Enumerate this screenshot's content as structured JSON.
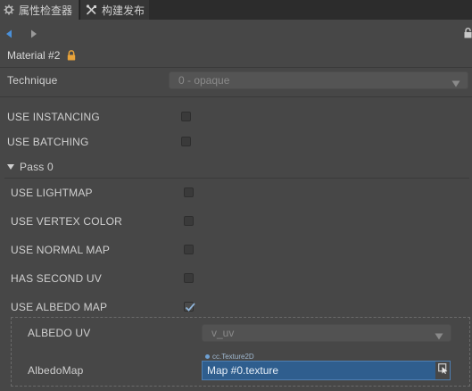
{
  "tabs": [
    {
      "label": "属性检查器",
      "icon": "gear-icon"
    },
    {
      "label": "构建发布",
      "icon": "tools-icon"
    }
  ],
  "header": {
    "title": "Material #2",
    "lock_icon": "lock-icon"
  },
  "technique": {
    "label": "Technique",
    "value": "0 - opaque"
  },
  "use_instancing": {
    "label": "USE INSTANCING",
    "checked": false
  },
  "use_batching": {
    "label": "USE BATCHING",
    "checked": false
  },
  "pass": {
    "label": "Pass 0",
    "expanded": true
  },
  "use_lightmap": {
    "label": "USE LIGHTMAP",
    "checked": false
  },
  "use_vertex_color": {
    "label": "USE VERTEX COLOR",
    "checked": false
  },
  "use_normal_map": {
    "label": "USE NORMAL MAP",
    "checked": false
  },
  "has_second_uv": {
    "label": "HAS SECOND UV",
    "checked": false
  },
  "use_albedo_map": {
    "label": "USE ALBEDO MAP",
    "checked": true
  },
  "albedo_uv": {
    "label": "ALBEDO UV",
    "value": "v_uv"
  },
  "albedo_map": {
    "label": "AlbedoMap",
    "type": "cc.Texture2D",
    "value": "Map #0.texture"
  },
  "colors": {
    "accent": "#2f5e8e",
    "lock": "#e8a33a",
    "nav_back": "#4a90d9"
  }
}
